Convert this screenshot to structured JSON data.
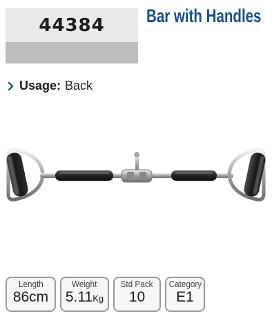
{
  "product": {
    "code": "44384",
    "title": "Bar with Handles",
    "usage_label": "Usage:",
    "usage_value": "Back",
    "image_alt": "bar-with-handles-photo"
  },
  "specs": {
    "length_label": "Length",
    "length_value": "86cm",
    "weight_label": "Weight",
    "weight_value": "5.11",
    "weight_unit": "Kg",
    "pack_label": "Std Pack",
    "pack_value": "10",
    "category_label": "Category",
    "category_value": "E1"
  },
  "colors": {
    "title": "#1e4d86",
    "chevron": "#1e4d86",
    "code_box_top": "#e9e9e9",
    "code_box_bottom": "#bdbdbd"
  }
}
